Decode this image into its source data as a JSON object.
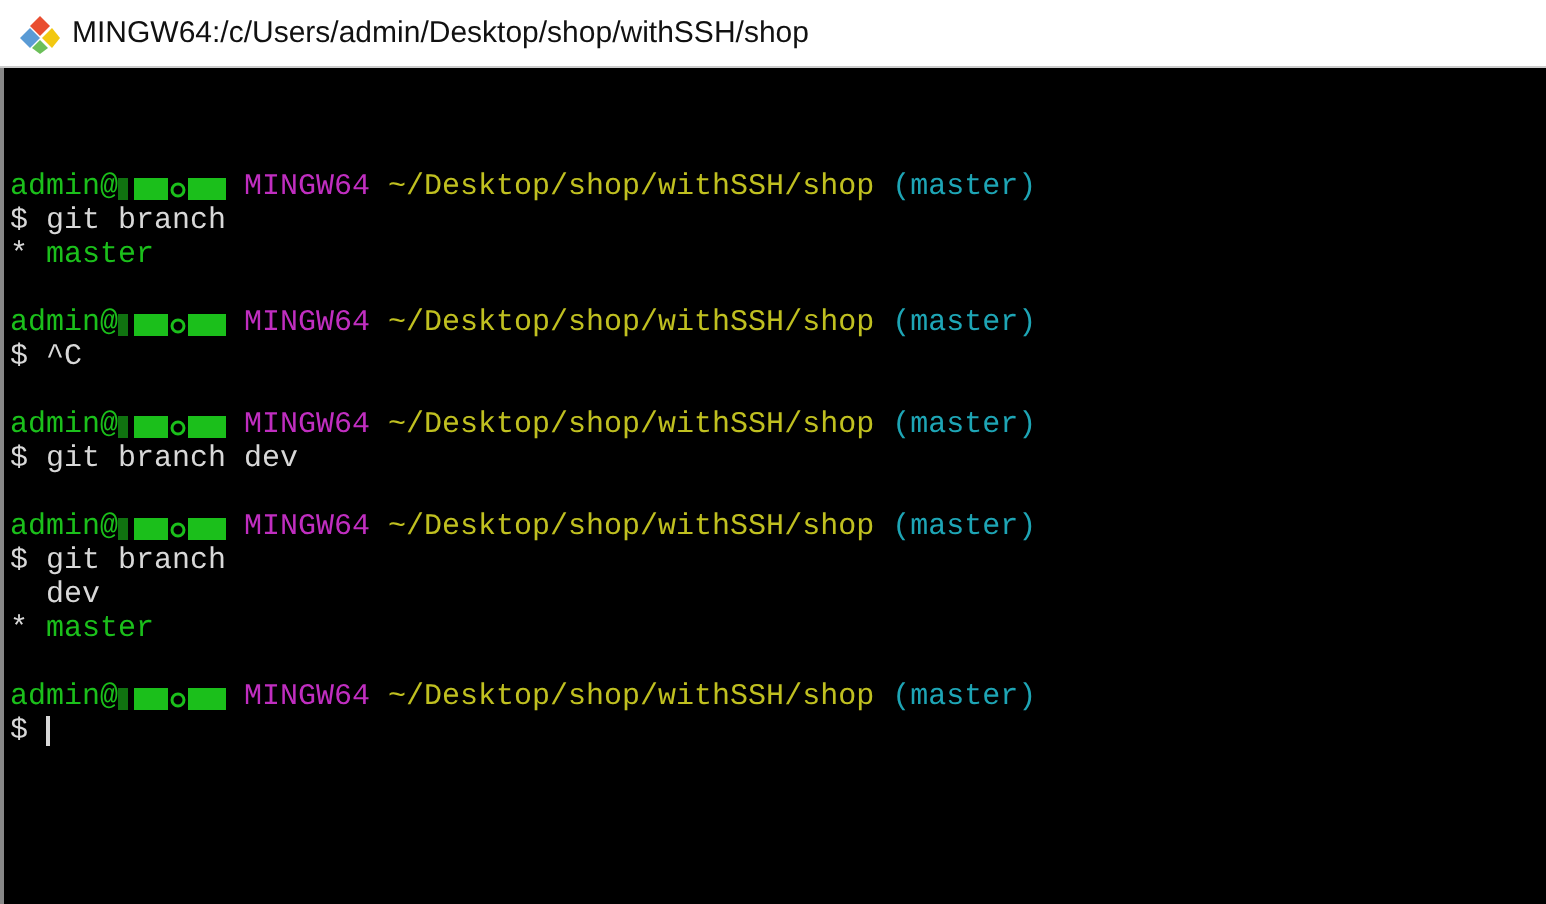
{
  "window": {
    "title": "MINGW64:/c/Users/admin/Desktop/shop/withSSH/shop"
  },
  "terminal": {
    "lines": [
      {
        "kind": "prompt",
        "user": "admin@",
        "shell": "MINGW64",
        "path": "~/Desktop/shop/withSSH/shop",
        "branch": "(master)"
      },
      {
        "kind": "command",
        "prompt": "$",
        "text": "git branch"
      },
      {
        "kind": "branch",
        "marker": "*",
        "name": "master",
        "selected": true
      },
      {
        "kind": "blank"
      },
      {
        "kind": "prompt",
        "user": "admin@",
        "shell": "MINGW64",
        "path": "~/Desktop/shop/withSSH/shop",
        "branch": "(master)"
      },
      {
        "kind": "command",
        "prompt": "$",
        "text": "^C"
      },
      {
        "kind": "blank"
      },
      {
        "kind": "prompt",
        "user": "admin@",
        "shell": "MINGW64",
        "path": "~/Desktop/shop/withSSH/shop",
        "branch": "(master)"
      },
      {
        "kind": "command",
        "prompt": "$",
        "text": "git branch dev"
      },
      {
        "kind": "blank"
      },
      {
        "kind": "prompt",
        "user": "admin@",
        "shell": "MINGW64",
        "path": "~/Desktop/shop/withSSH/shop",
        "branch": "(master)"
      },
      {
        "kind": "command",
        "prompt": "$",
        "text": "git branch"
      },
      {
        "kind": "branch",
        "name": "dev",
        "selected": false
      },
      {
        "kind": "branch",
        "marker": "*",
        "name": "master",
        "selected": true
      },
      {
        "kind": "blank"
      },
      {
        "kind": "prompt",
        "user": "admin@",
        "shell": "MINGW64",
        "path": "~/Desktop/shop/withSSH/shop",
        "branch": "(master)"
      },
      {
        "kind": "command",
        "prompt": "$",
        "cursor": true
      }
    ]
  }
}
